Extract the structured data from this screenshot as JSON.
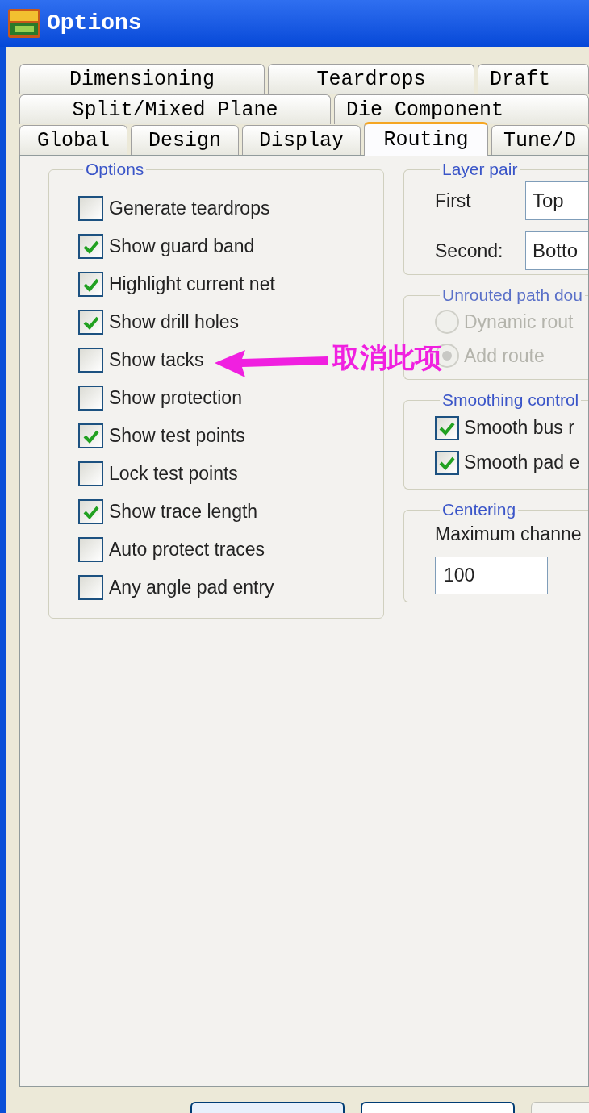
{
  "window": {
    "title": "Options"
  },
  "tab_rows": [
    [
      {
        "label": "Dimensioning",
        "selected": false
      },
      {
        "label": "Teardrops",
        "selected": false
      },
      {
        "label": "Draft",
        "selected": false
      }
    ],
    [
      {
        "label": "Split/Mixed Plane",
        "selected": false
      },
      {
        "label": "Die Component",
        "selected": false
      }
    ],
    [
      {
        "label": "Global",
        "selected": false
      },
      {
        "label": "Design",
        "selected": false
      },
      {
        "label": "Display",
        "selected": false
      },
      {
        "label": "Routing",
        "selected": true
      },
      {
        "label": "Tune/D",
        "selected": false
      }
    ]
  ],
  "options_group": {
    "title": "Options",
    "items": [
      {
        "label": "Generate teardrops",
        "checked": false
      },
      {
        "label": "Show guard band",
        "checked": true
      },
      {
        "label": "Highlight current net",
        "checked": true
      },
      {
        "label": "Show drill holes",
        "checked": true
      },
      {
        "label": "Show tacks",
        "checked": false
      },
      {
        "label": "Show protection",
        "checked": false
      },
      {
        "label": "Show test points",
        "checked": true
      },
      {
        "label": "Lock test points",
        "checked": false
      },
      {
        "label": "Show trace length",
        "checked": true
      },
      {
        "label": "Auto protect traces",
        "checked": false
      },
      {
        "label": "Any angle pad entry",
        "checked": false
      }
    ]
  },
  "layer_pair": {
    "title": "Layer pair",
    "fields": [
      {
        "label": "First",
        "value": "Top"
      },
      {
        "label": "Second:",
        "value": "Botto"
      }
    ]
  },
  "unrouted": {
    "title": "Unrouted path dou",
    "disabled": true,
    "options": [
      {
        "label": "Dynamic rout",
        "selected": false
      },
      {
        "label": "Add route",
        "selected": true
      }
    ]
  },
  "smoothing": {
    "title": "Smoothing control",
    "items": [
      {
        "label": "Smooth bus r",
        "checked": true
      },
      {
        "label": "Smooth pad e",
        "checked": true
      }
    ]
  },
  "centering": {
    "title": "Centering",
    "label": "Maximum channe",
    "value": "100"
  },
  "annotation": {
    "text": "取消此项"
  }
}
